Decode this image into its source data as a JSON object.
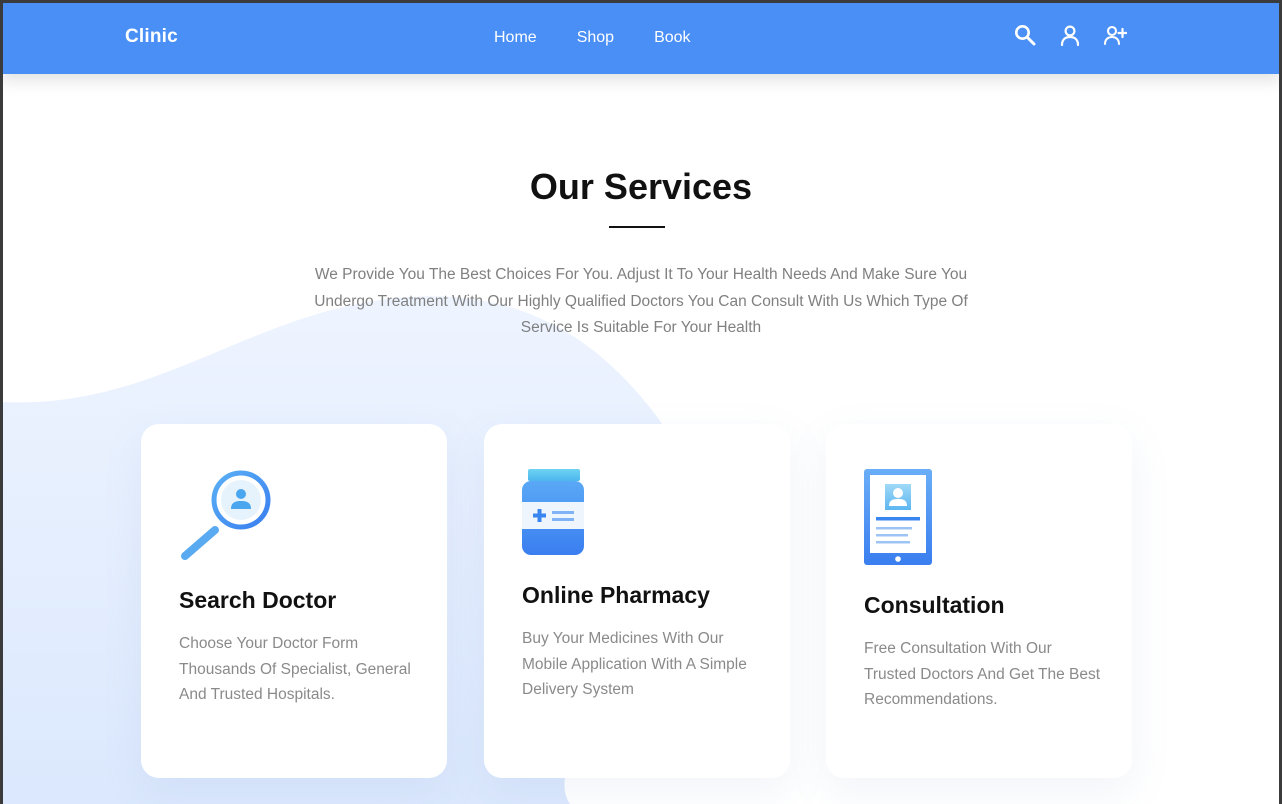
{
  "brand": "Clinic",
  "nav": {
    "links": [
      "Home",
      "Shop",
      "Book"
    ],
    "icons": [
      "search-icon",
      "user-icon",
      "user-add-icon"
    ]
  },
  "services": {
    "title": "Our Services",
    "subtitle": "We Provide You The Best Choices For You. Adjust It To Your Health Needs And Make Sure You Undergo Treatment With Our Highly Qualified Doctors You Can Consult With Us Which Type Of Service Is Suitable For Your Health",
    "cards": [
      {
        "title": "Search Doctor",
        "description": "Choose Your Doctor Form Thousands Of Specialist, General And Trusted Hospitals.",
        "icon": "magnifier-doctor-icon"
      },
      {
        "title": "Online Pharmacy",
        "description": "Buy Your Medicines With Our Mobile Application With A Simple Delivery System",
        "icon": "medicine-bottle-icon"
      },
      {
        "title": "Consultation",
        "description": "Free Consultation With Our Trusted Doctors And Get The Best Recommendations.",
        "icon": "tablet-profile-icon"
      }
    ]
  },
  "colors": {
    "primary": "#4a8ff5",
    "blob": "#eaf2ff",
    "heading": "#111111",
    "muted": "#8a8a8a"
  }
}
